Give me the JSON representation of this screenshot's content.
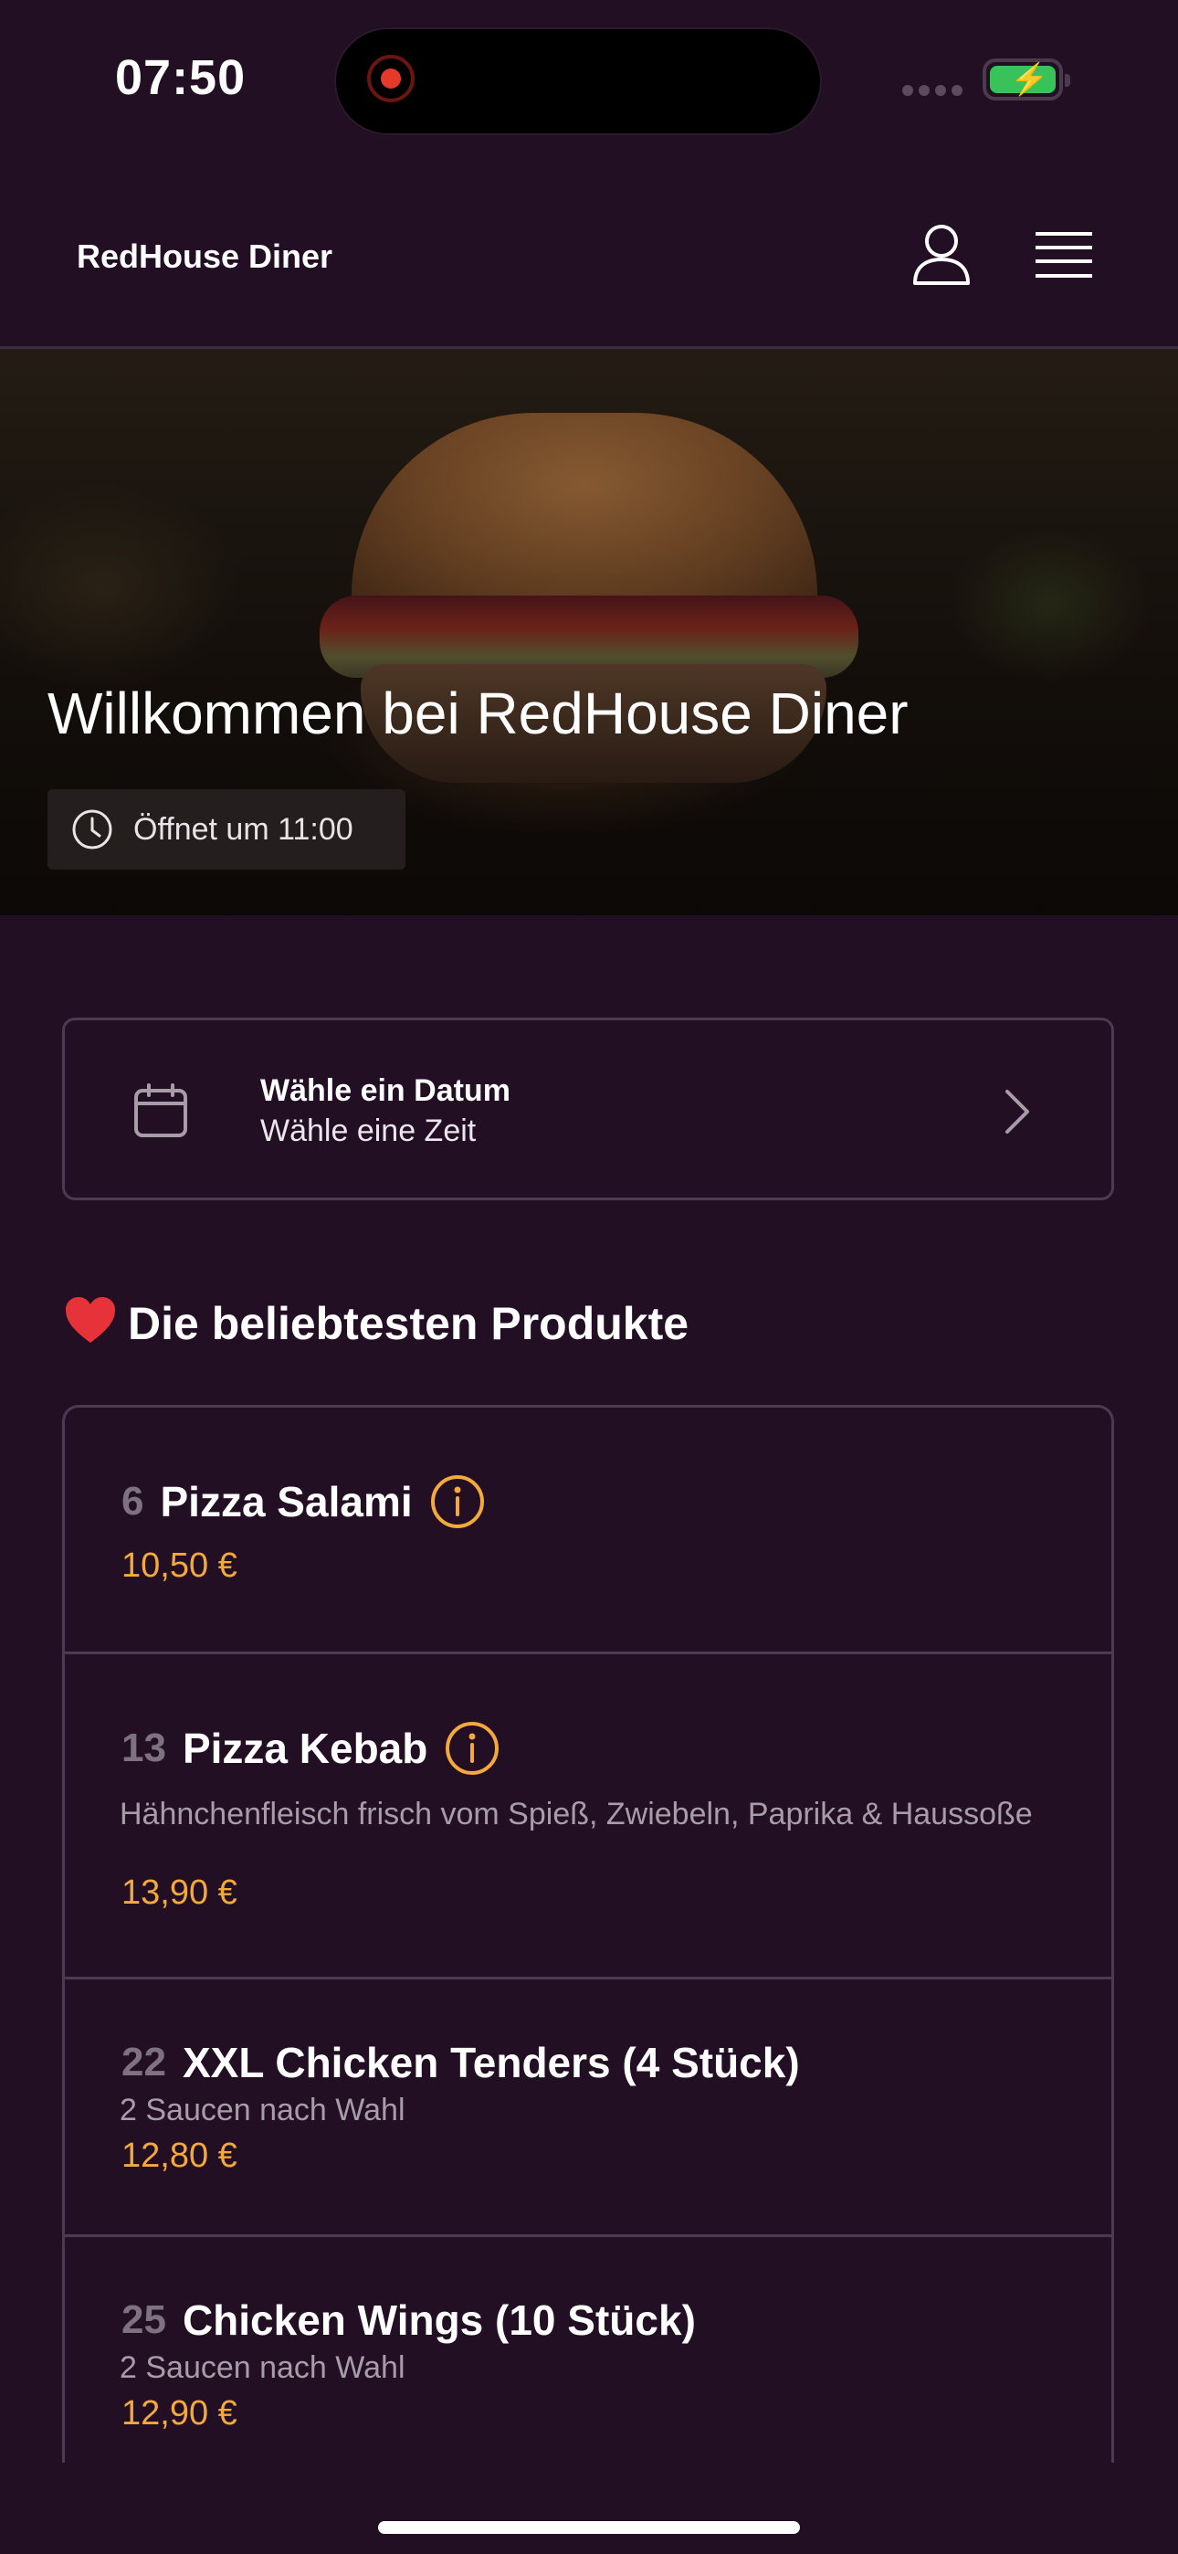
{
  "status_bar": {
    "time": "07:50",
    "battery_color": "#3ac25a"
  },
  "header": {
    "brand": "RedHouse Diner",
    "icons": [
      "user-icon",
      "menu-icon"
    ]
  },
  "hero": {
    "title": "Willkommen bei RedHouse Diner",
    "open_status": "Öffnet um 11:00"
  },
  "date_picker": {
    "title": "Wähle ein Datum",
    "subtitle": "Wähle eine Zeit"
  },
  "popular": {
    "title": "Die beliebtesten Produkte",
    "items": [
      {
        "number": "6",
        "name": "Pizza Salami",
        "description": "",
        "price": "10,50 €",
        "has_info": true
      },
      {
        "number": "13",
        "name": "Pizza Kebab",
        "description": "Hähnchenfleisch frisch vom Spieß, Zwiebeln, Paprika & Haussoße",
        "price": "13,90 €",
        "has_info": true
      },
      {
        "number": "22",
        "name": "XXL Chicken Tenders (4 Stück)",
        "description": "2 Saucen nach Wahl",
        "price": "12,80 €",
        "has_info": false
      },
      {
        "number": "25",
        "name": "Chicken Wings (10 Stück)",
        "description": "2 Saucen nach Wahl",
        "price": "12,90 €",
        "has_info": false
      }
    ]
  },
  "colors": {
    "background": "#220f24",
    "accent_price": "#f3a93b",
    "border": "#4d3a52"
  }
}
